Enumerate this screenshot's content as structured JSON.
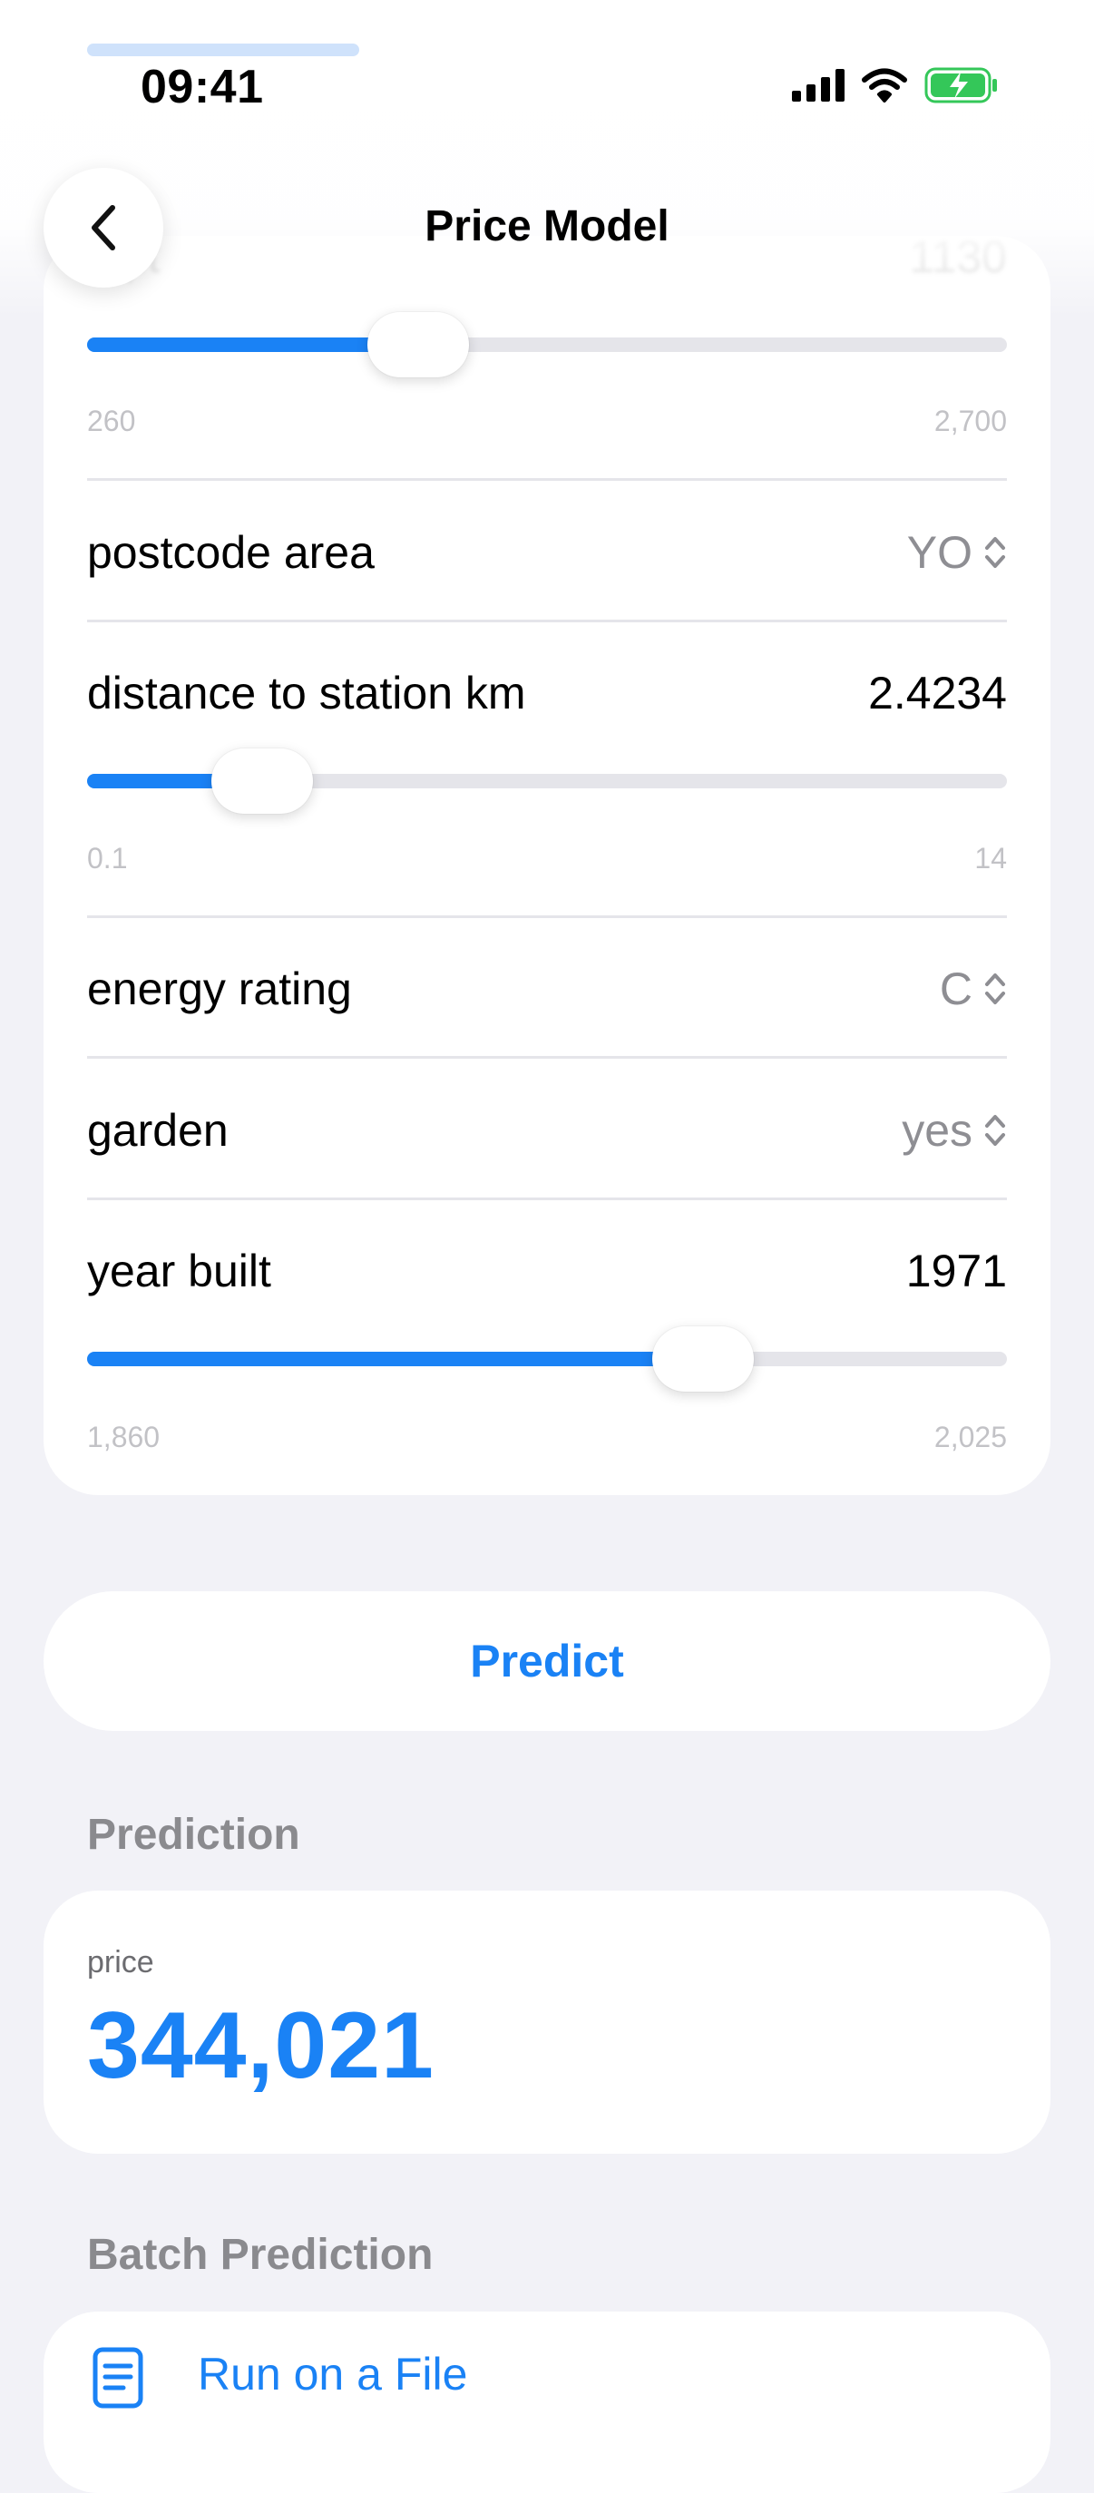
{
  "status_bar": {
    "time": "09:41",
    "icons": [
      "cellular-signal-icon",
      "wifi-icon",
      "battery-charging-icon"
    ]
  },
  "header": {
    "title": "Price Model",
    "back_icon": "chevron-left-icon"
  },
  "colors": {
    "accent": "#1a82f5",
    "background": "#f2f2f7",
    "card": "#ffffff",
    "secondary_text": "#8e8e93",
    "battery": "#34c759"
  },
  "form": {
    "sqft": {
      "label": "sqft",
      "value": "1130",
      "min": "260",
      "max": "2,700",
      "slider_fraction": 0.36
    },
    "postcode_area": {
      "label": "postcode area",
      "value": "YO",
      "icon": "chevron-up-down-icon"
    },
    "distance_to_station": {
      "label": "distance to station km",
      "value": "2.4234",
      "min": "0.1",
      "max": "14",
      "slider_fraction": 0.19
    },
    "energy_rating": {
      "label": "energy rating",
      "value": "C",
      "icon": "chevron-up-down-icon"
    },
    "garden": {
      "label": "garden",
      "value": "yes",
      "icon": "chevron-up-down-icon"
    },
    "year_built": {
      "label": "year built",
      "value": "1971",
      "min": "1,860",
      "max": "2,025",
      "slider_fraction": 0.67
    }
  },
  "predict_button": {
    "label": "Predict"
  },
  "prediction": {
    "section_title": "Prediction",
    "label": "price",
    "value": "344,021"
  },
  "batch": {
    "section_title": "Batch Prediction",
    "run_label": "Run on a File",
    "icon": "document-icon"
  }
}
